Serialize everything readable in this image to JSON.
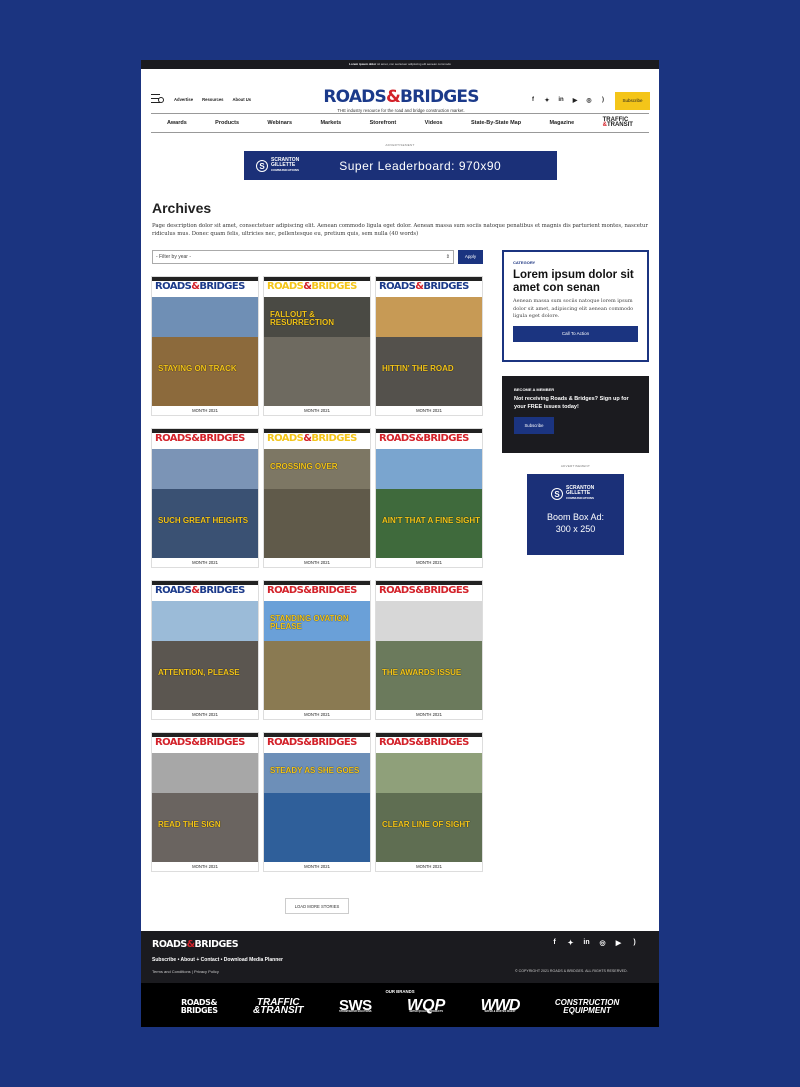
{
  "topbar": {
    "lead": "Lorem ipsum dolor",
    "rest": "sit amet, con sectetuer adipiscing elit aenean commodo"
  },
  "header": {
    "links": [
      "Advertise",
      "Resources",
      "About Us"
    ],
    "logo_left": "ROADS",
    "logo_amp": "&",
    "logo_right": "BRIDGES",
    "tagline": "THE industry resource for the road and bridge construction market.",
    "social_icons": [
      "facebook-icon",
      "twitter-icon",
      "linkedin-icon",
      "youtube-icon",
      "instagram-icon",
      "rss-icon"
    ],
    "subscribe_label": "Subscribe"
  },
  "nav": {
    "items": [
      "Awards",
      "Products",
      "Webinars",
      "Markets",
      "Storefront",
      "Videos",
      "State-By-State Map",
      "Magazine"
    ],
    "brand_traffic": "TRAFFIC",
    "brand_amp": "&",
    "brand_transit": "TRANSIT"
  },
  "ads": {
    "label": "ADVERTISEMENT",
    "leader_text": "Super Leaderboard: 970x90",
    "sponsor_logo_glyph": "S",
    "sponsor_line1": "SCRANTON",
    "sponsor_line2": "GILLETTE",
    "sponsor_line3": "COMMUNICATIONS",
    "boombox_line1": "Boom Box Ad:",
    "boombox_line2": "300 x 250"
  },
  "archives": {
    "title": "Archives",
    "description": "Page description dolor sit amet, consectetuer adipiscing elit. Aenean commodo ligula eget dolor. Aenean massa sum sociis natoque penatibus et magnis dis parturient montes, nascetur ridiculus mus. Donec quam felis, ultricies nec, pellentesque eu, pretium quis, sem nulla  (40 words)",
    "filter_placeholder": "- Filter by year -",
    "apply_label": "Apply",
    "load_more_label": "LOAD MORE STORIES"
  },
  "covers": [
    {
      "headline": "STAYING ON TRACK",
      "month": "MONTH 2021",
      "bg": "#8c6a3c",
      "sky": "#6f8fb5",
      "mast": "#1b3a8a"
    },
    {
      "headline": "FALLOUT & RESURRECTION",
      "month": "MONTH 2021",
      "bg": "#6e6a60",
      "sky": "#4a4a44",
      "mast": "#f4c519"
    },
    {
      "headline": "HITTIN' THE ROAD",
      "month": "MONTH 2021",
      "bg": "#54514c",
      "sky": "#c79a55",
      "mast": "#1b3a8a"
    },
    {
      "headline": "SUCH GREAT HEIGHTS",
      "month": "MONTH 2021",
      "bg": "#3a5173",
      "sky": "#7b94b6",
      "mast": "#d3222a"
    },
    {
      "headline": "CROSSING OVER",
      "month": "MONTH 2021",
      "bg": "#605a4a",
      "sky": "#7d7764",
      "mast": "#f4c519"
    },
    {
      "headline": "AIN'T THAT A FINE SIGHT",
      "month": "MONTH 2021",
      "bg": "#3f6a3c",
      "sky": "#7aa5cf",
      "mast": "#d3222a"
    },
    {
      "headline": "ATTENTION, PLEASE",
      "month": "MONTH 2021",
      "bg": "#5b5650",
      "sky": "#9bbbd8",
      "mast": "#1b3a8a"
    },
    {
      "headline": "STANDING OVATION PLEASE",
      "month": "MONTH 2021",
      "bg": "#8a7a52",
      "sky": "#6aa0d8",
      "mast": "#d3222a"
    },
    {
      "headline": "THE AWARDS ISSUE",
      "month": "MONTH 2021",
      "bg": "#6b7a5c",
      "sky": "#d7d7d7",
      "mast": "#d3222a"
    },
    {
      "headline": "READ THE SIGN",
      "month": "MONTH 2021",
      "bg": "#6a6460",
      "sky": "#a7a7a7",
      "mast": "#d3222a"
    },
    {
      "headline": "STEADY AS SHE GOES",
      "month": "MONTH 2021",
      "bg": "#2f5f9a",
      "sky": "#6d8fb8",
      "mast": "#d3222a"
    },
    {
      "headline": "CLEAR LINE OF SIGHT",
      "month": "MONTH 2021",
      "bg": "#5f6e52",
      "sky": "#8fa07a",
      "mast": "#d3222a"
    }
  ],
  "sidebar": {
    "category_label": "CATEGORY",
    "category_title": "Lorem ipsum dolor sit amet con senan",
    "category_text": "Aenean massa sum sociis natoque lorem ipsum dolor sit amet, adipiscing elit aenean commodo ligula eget dolore.",
    "cta_label": "Call To Action",
    "member_label": "BECOME A MEMBER",
    "member_text": "Not receiving Roads & Bridges?  Sign up for your FREE issues today!",
    "member_button": "Subscribe"
  },
  "footer": {
    "logo_left": "ROADS",
    "logo_amp": "&",
    "logo_right": "BRIDGES",
    "links": "Subscribe  •  About + Contact  •  Download Media Planner",
    "legal": "Terms and Conditions  |  Privacy Policy",
    "copyright": "© COPYRIGHT 2021 ROADS & BRIDGES. ALL RIGHTS RESERVED.",
    "brands_label": "OUR BRANDS",
    "brand1_top": "ROADS&",
    "brand1_bottom": "BRIDGES",
    "brand2_top": "TRAFFIC",
    "brand2_bottom": "&TRANSIT",
    "brand3": "SWS",
    "brand3_sub": "STORM WATER SOLUTIONS",
    "brand4": "WQP",
    "brand4_sub": "WATER QUALITY PRODUCTS",
    "brand5": "WWD",
    "brand5_sub": "WATER & WASTES DIGEST",
    "brand6_top": "CONSTRUCTION",
    "brand6_bottom": "EQUIPMENT"
  },
  "colors": {
    "brand_blue": "#1b3480",
    "accent_yellow": "#f4c519",
    "accent_red": "#d3222a",
    "dark": "#1b1b1f"
  }
}
